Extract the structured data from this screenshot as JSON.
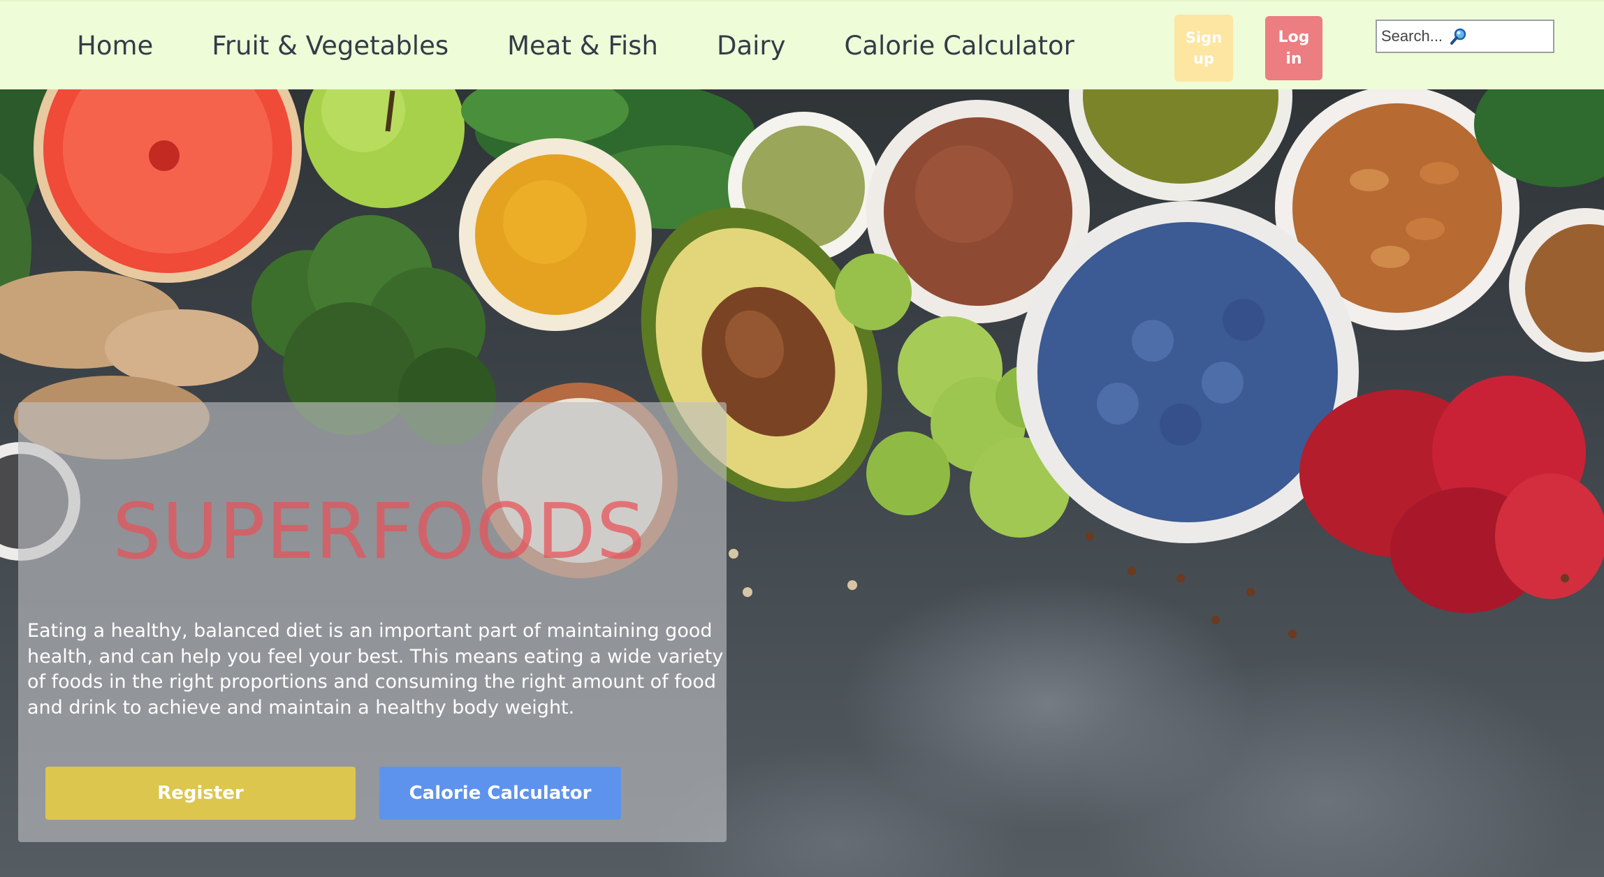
{
  "nav": {
    "links": [
      {
        "label": "Home"
      },
      {
        "label": "Fruit & Vegetables"
      },
      {
        "label": "Meat & Fish"
      },
      {
        "label": "Dairy"
      },
      {
        "label": "Calorie Calculator"
      }
    ],
    "signup_label": "Sign up",
    "login_label": "Log in",
    "search_placeholder": "Search...",
    "search_icon": "magnifier-icon"
  },
  "hero": {
    "title": "SUPERFOODS",
    "body": "Eating a healthy, balanced diet is an important part of maintaining good health, and can help you feel your best. This means eating a wide variety of foods in the right proportions and consuming the right amount of food and drink to achieve and maintain a healthy body weight.",
    "register_label": "Register",
    "calculator_label": "Calorie Calculator"
  },
  "colors": {
    "nav_background": "#eefcd8",
    "signup_button": "#fde6a2",
    "login_button": "#ec7d80",
    "title_red": "#e85058",
    "register_button": "#dcc64e",
    "calculator_button": "#5d93ec"
  }
}
